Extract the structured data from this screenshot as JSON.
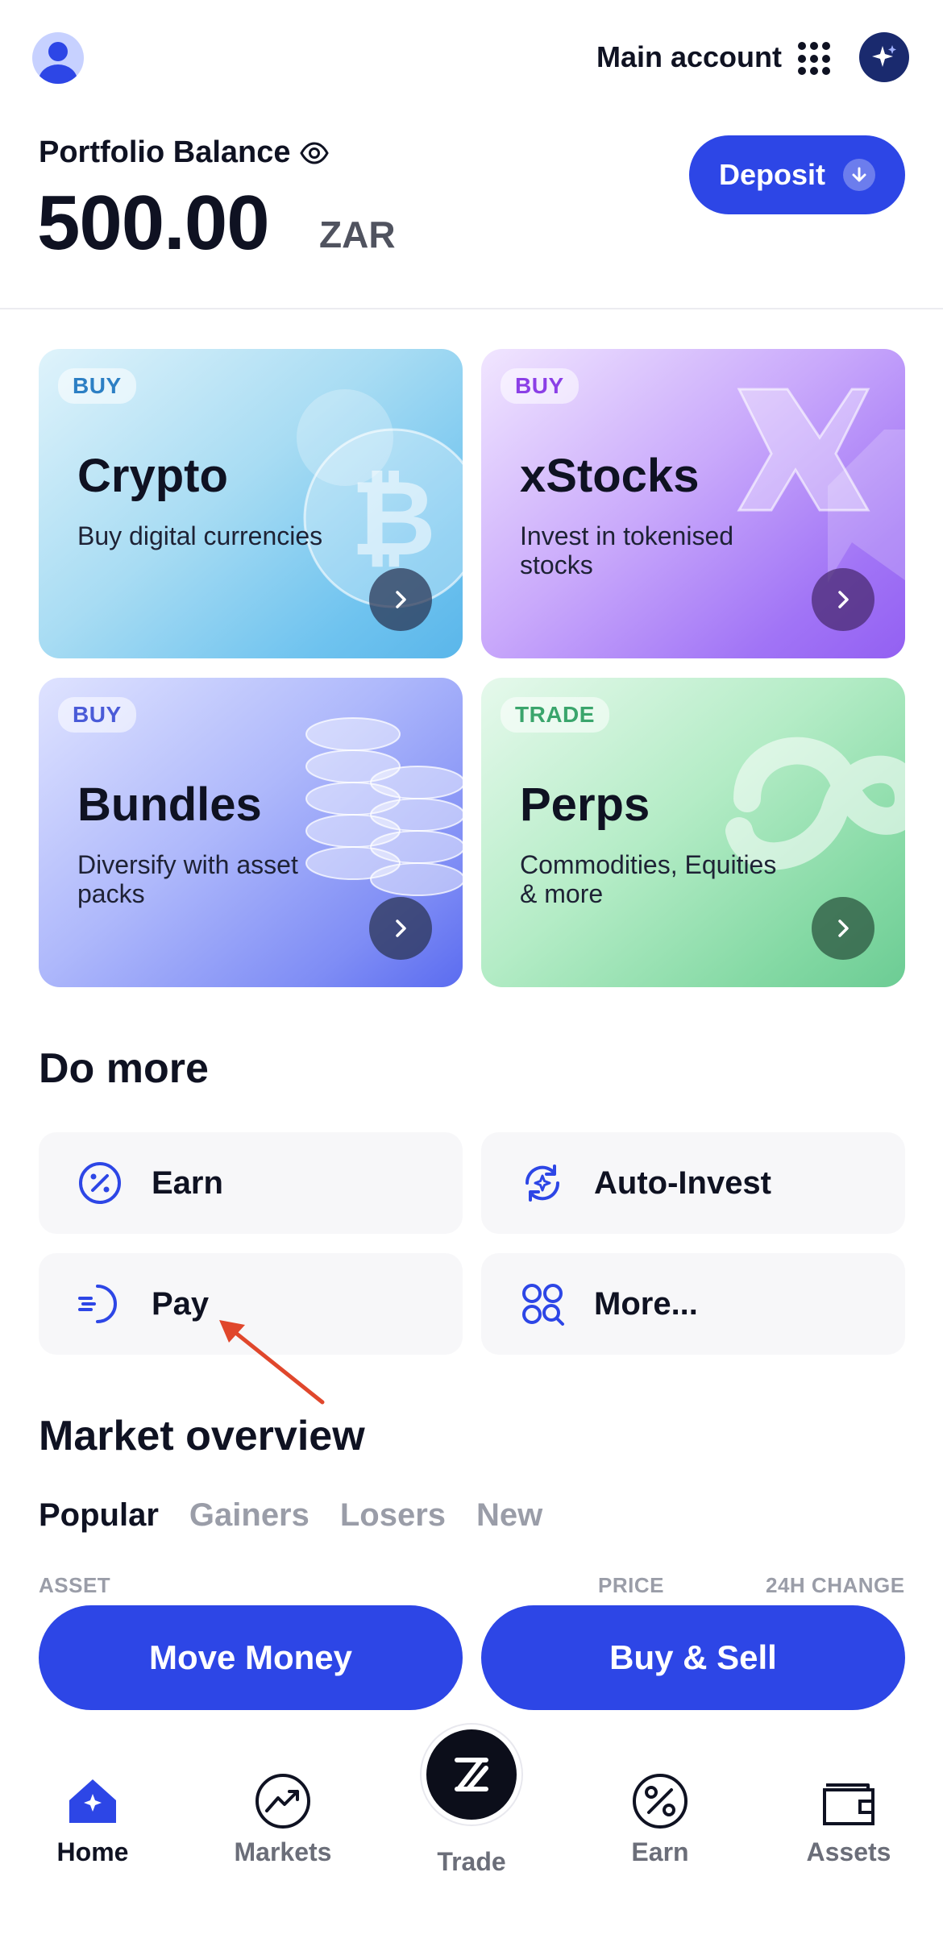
{
  "header": {
    "account_label": "Main account",
    "icons": [
      "avatar-icon",
      "app-grid-icon",
      "ai-sparkle-icon"
    ]
  },
  "balance": {
    "label": "Portfolio Balance",
    "amount": "500.00",
    "currency": "ZAR",
    "deposit_label": "Deposit"
  },
  "cards": [
    {
      "tag": "BUY",
      "title": "Crypto",
      "subtitle": "Buy digital currencies"
    },
    {
      "tag": "BUY",
      "title": "xStocks",
      "subtitle": "Invest in tokenised stocks"
    },
    {
      "tag": "BUY",
      "title": "Bundles",
      "subtitle": "Diversify with asset packs"
    },
    {
      "tag": "TRADE",
      "title": "Perps",
      "subtitle": "Commodities, Equities & more"
    }
  ],
  "do_more": {
    "title": "Do more",
    "actions": [
      {
        "label": "Earn",
        "icon": "percent-circle-icon"
      },
      {
        "label": "Auto-Invest",
        "icon": "auto-invest-icon"
      },
      {
        "label": "Pay",
        "icon": "pay-icon"
      },
      {
        "label": "More...",
        "icon": "more-apps-icon"
      }
    ]
  },
  "market_overview": {
    "title": "Market overview",
    "tabs": [
      "Popular",
      "Gainers",
      "Losers",
      "New"
    ],
    "active_tab": "Popular",
    "columns": {
      "asset": "ASSET",
      "price": "PRICE",
      "change": "24H CHANGE"
    }
  },
  "buttons": {
    "move_money": "Move Money",
    "buy_sell": "Buy & Sell"
  },
  "nav": {
    "items": [
      {
        "label": "Home",
        "icon": "home-icon"
      },
      {
        "label": "Markets",
        "icon": "markets-icon"
      },
      {
        "label": "Trade",
        "icon": "trade-icon"
      },
      {
        "label": "Earn",
        "icon": "earn-icon"
      },
      {
        "label": "Assets",
        "icon": "wallet-icon"
      }
    ],
    "active": "Home"
  },
  "colors": {
    "primary": "#2d46e6",
    "text": "#0f1222",
    "muted": "#9a9da8",
    "annotation_arrow": "#e0472c"
  }
}
